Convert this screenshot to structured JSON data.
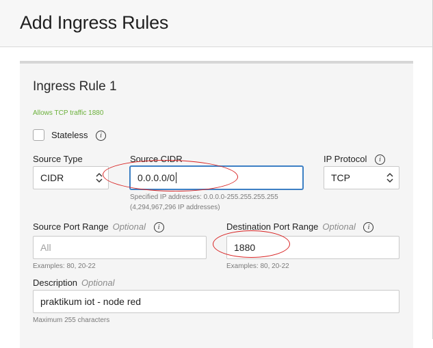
{
  "header": {
    "title": "Add Ingress Rules"
  },
  "rule": {
    "title": "Ingress Rule 1",
    "summary": "Allows TCP traffic 1880",
    "stateless": {
      "label": "Stateless",
      "checked": false
    },
    "source_type": {
      "label": "Source Type",
      "value": "CIDR"
    },
    "source_cidr": {
      "label": "Source CIDR",
      "value": "0.0.0.0/0",
      "note_line1": "Specified IP addresses: 0.0.0.0-255.255.255.255",
      "note_line2": "(4,294,967,296 IP addresses)"
    },
    "ip_protocol": {
      "label": "IP Protocol",
      "value": "TCP"
    },
    "source_port": {
      "label": "Source Port Range",
      "optional": "Optional",
      "placeholder": "All",
      "value": "",
      "note": "Examples: 80, 20-22"
    },
    "destination_port": {
      "label": "Destination Port Range",
      "optional": "Optional",
      "value": "1880",
      "note": "Examples: 80, 20-22"
    },
    "description": {
      "label": "Description",
      "optional": "Optional",
      "value": "praktikum iot - node red",
      "note": "Maximum 255 characters"
    }
  },
  "icons": {
    "info": "i"
  },
  "colors": {
    "annotation": "#d82222",
    "focus": "#3c7fc4",
    "hint": "#6bb03a"
  }
}
